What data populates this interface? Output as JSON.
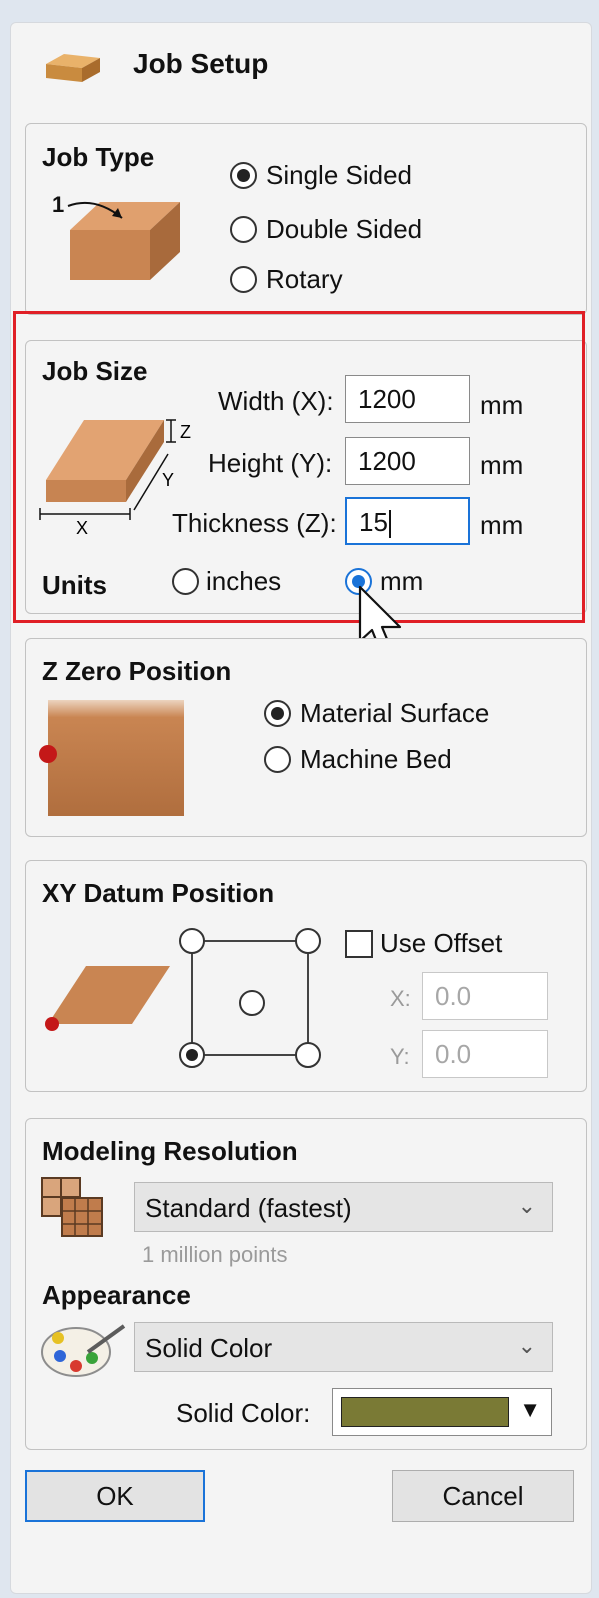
{
  "header": {
    "title": "Job Setup",
    "icon": "wood-block-icon"
  },
  "job_type": {
    "title": "Job Type",
    "diagram_label": "1",
    "options": [
      {
        "label": "Single Sided",
        "selected": true
      },
      {
        "label": "Double Sided",
        "selected": false
      },
      {
        "label": "Rotary",
        "selected": false
      }
    ]
  },
  "job_size": {
    "title": "Job Size",
    "diagram_labels": {
      "x": "X",
      "y": "Y",
      "z": "Z"
    },
    "width_label": "Width (X):",
    "width_value": "1200",
    "height_label": "Height (Y):",
    "height_value": "1200",
    "thickness_label": "Thickness (Z):",
    "thickness_value": "15",
    "unit": "mm",
    "units_label": "Units",
    "units_options": [
      {
        "label": "inches",
        "selected": false
      },
      {
        "label": "mm",
        "selected": true
      }
    ]
  },
  "z_zero": {
    "title": "Z Zero Position",
    "options": [
      {
        "label": "Material Surface",
        "selected": true
      },
      {
        "label": "Machine Bed",
        "selected": false
      }
    ]
  },
  "xy_datum": {
    "title": "XY Datum Position",
    "use_offset_label": "Use Offset",
    "x_label": "X:",
    "x_value": "0.0",
    "y_label": "Y:",
    "y_value": "0.0",
    "selected_point": "bottom-left"
  },
  "modeling": {
    "title": "Modeling Resolution",
    "resolution_value": "Standard (fastest)",
    "resolution_hint": "1 million points",
    "appearance_title": "Appearance",
    "appearance_value": "Solid Color",
    "solid_color_label": "Solid Color:",
    "solid_color": "#7a7a35"
  },
  "buttons": {
    "ok": "OK",
    "cancel": "Cancel"
  },
  "colors": {
    "accent": "#1a73d8",
    "highlight": "#e01f26",
    "wood": "#c88a55"
  }
}
